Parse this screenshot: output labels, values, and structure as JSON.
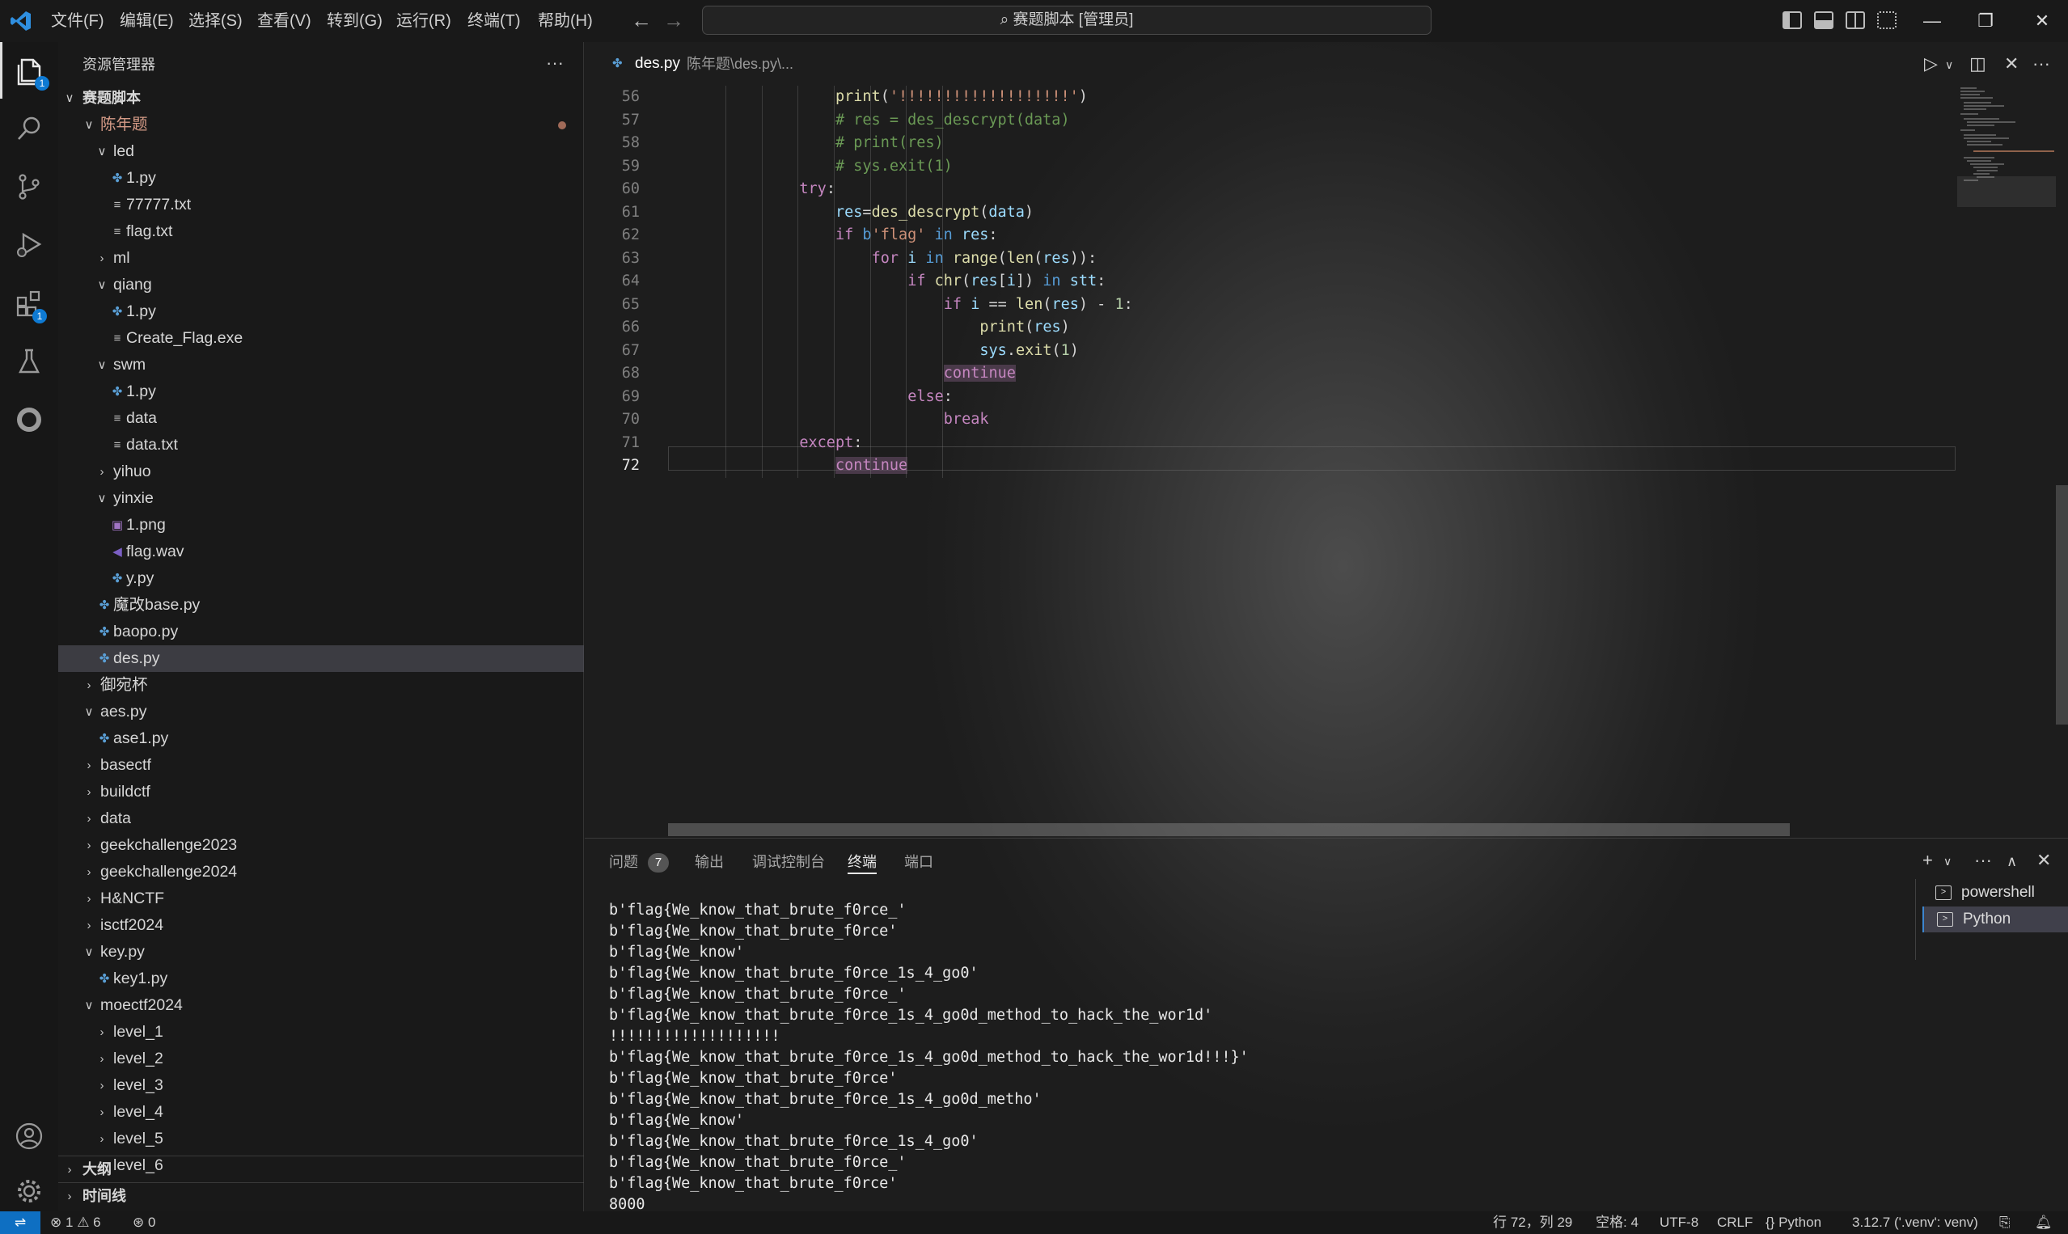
{
  "menu": [
    "文件(F)",
    "编辑(E)",
    "选择(S)",
    "查看(V)",
    "转到(G)",
    "运行(R)",
    "终端(T)",
    "帮助(H)"
  ],
  "command_center": "赛题脚本 [管理员]",
  "activity": {
    "explorer_badge": "1",
    "extensions_badge": "1"
  },
  "sidebar": {
    "title": "资源管理器",
    "more": "···",
    "root": "赛题脚本",
    "tree": [
      {
        "label": "陈年题",
        "depth": 1,
        "type": "folder-open",
        "modified": true
      },
      {
        "label": "led",
        "depth": 2,
        "type": "folder-open"
      },
      {
        "label": "1.py",
        "depth": 3,
        "type": "py"
      },
      {
        "label": "77777.txt",
        "depth": 3,
        "type": "txt"
      },
      {
        "label": "flag.txt",
        "depth": 3,
        "type": "txt"
      },
      {
        "label": "ml",
        "depth": 2,
        "type": "folder"
      },
      {
        "label": "qiang",
        "depth": 2,
        "type": "folder-open"
      },
      {
        "label": "1.py",
        "depth": 3,
        "type": "py"
      },
      {
        "label": "Create_Flag.exe",
        "depth": 3,
        "type": "txt"
      },
      {
        "label": "swm",
        "depth": 2,
        "type": "folder-open"
      },
      {
        "label": "1.py",
        "depth": 3,
        "type": "py"
      },
      {
        "label": "data",
        "depth": 3,
        "type": "txt"
      },
      {
        "label": "data.txt",
        "depth": 3,
        "type": "txt"
      },
      {
        "label": "yihuo",
        "depth": 2,
        "type": "folder"
      },
      {
        "label": "yinxie",
        "depth": 2,
        "type": "folder-open"
      },
      {
        "label": "1.png",
        "depth": 3,
        "type": "img"
      },
      {
        "label": "flag.wav",
        "depth": 3,
        "type": "wav"
      },
      {
        "label": "y.py",
        "depth": 3,
        "type": "py"
      },
      {
        "label": "魔改base.py",
        "depth": 2,
        "type": "py"
      },
      {
        "label": "baopo.py",
        "depth": 2,
        "type": "py"
      },
      {
        "label": "des.py",
        "depth": 2,
        "type": "py",
        "selected": true
      },
      {
        "label": "御宛杯",
        "depth": 1,
        "type": "folder"
      },
      {
        "label": "aes.py",
        "depth": 1,
        "type": "folder-open"
      },
      {
        "label": "ase1.py",
        "depth": 2,
        "type": "py"
      },
      {
        "label": "basectf",
        "depth": 1,
        "type": "folder"
      },
      {
        "label": "buildctf",
        "depth": 1,
        "type": "folder"
      },
      {
        "label": "data",
        "depth": 1,
        "type": "folder"
      },
      {
        "label": "geekchallenge2023",
        "depth": 1,
        "type": "folder"
      },
      {
        "label": "geekchallenge2024",
        "depth": 1,
        "type": "folder"
      },
      {
        "label": "H&NCTF",
        "depth": 1,
        "type": "folder"
      },
      {
        "label": "isctf2024",
        "depth": 1,
        "type": "folder"
      },
      {
        "label": "key.py",
        "depth": 1,
        "type": "folder-open"
      },
      {
        "label": "key1.py",
        "depth": 2,
        "type": "py"
      },
      {
        "label": "moectf2024",
        "depth": 1,
        "type": "folder-open"
      },
      {
        "label": "level_1",
        "depth": 2,
        "type": "folder"
      },
      {
        "label": "level_2",
        "depth": 2,
        "type": "folder"
      },
      {
        "label": "level_3",
        "depth": 2,
        "type": "folder"
      },
      {
        "label": "level_4",
        "depth": 2,
        "type": "folder"
      },
      {
        "label": "level_5",
        "depth": 2,
        "type": "folder"
      },
      {
        "label": "level_6",
        "depth": 2,
        "type": "folder"
      }
    ],
    "outline": "大纲",
    "timeline": "时间线"
  },
  "editor": {
    "tab_title": "des.py",
    "tab_path": "陈年题\\des.py\\...",
    "lines": [
      {
        "n": "56",
        "indent": 5,
        "tokens": [
          [
            "fn",
            "print"
          ],
          [
            "p",
            "("
          ],
          [
            "str",
            "'!!!!!!!!!!!!!!!!!!!'"
          ],
          [
            "p",
            ")"
          ]
        ]
      },
      {
        "n": "57",
        "indent": 5,
        "tokens": [
          [
            "cm",
            "# res = des_descrypt(data)"
          ]
        ]
      },
      {
        "n": "58",
        "indent": 5,
        "tokens": [
          [
            "cm",
            "# print(res)"
          ]
        ]
      },
      {
        "n": "59",
        "indent": 5,
        "tokens": [
          [
            "cm",
            "# sys.exit(1)"
          ]
        ]
      },
      {
        "n": "60",
        "indent": 4,
        "tokens": [
          [
            "kw",
            "try"
          ],
          [
            "p",
            ":"
          ]
        ]
      },
      {
        "n": "61",
        "indent": 5,
        "tokens": [
          [
            "var",
            "res"
          ],
          [
            "p",
            "="
          ],
          [
            "fn",
            "des_descrypt"
          ],
          [
            "p",
            "("
          ],
          [
            "var",
            "data"
          ],
          [
            "p",
            ")"
          ]
        ]
      },
      {
        "n": "62",
        "indent": 5,
        "tokens": [
          [
            "kw",
            "if "
          ],
          [
            "kw2",
            "b"
          ],
          [
            "str",
            "'flag'"
          ],
          [
            "kw2",
            " in "
          ],
          [
            "var",
            "res"
          ],
          [
            "p",
            ":"
          ]
        ]
      },
      {
        "n": "63",
        "indent": 6,
        "tokens": [
          [
            "kw",
            "for "
          ],
          [
            "var",
            "i"
          ],
          [
            "kw2",
            " in "
          ],
          [
            "fn",
            "range"
          ],
          [
            "p",
            "("
          ],
          [
            "fn",
            "len"
          ],
          [
            "p",
            "("
          ],
          [
            "var",
            "res"
          ],
          [
            "p",
            "))"
          ],
          [
            "p",
            ":"
          ]
        ]
      },
      {
        "n": "64",
        "indent": 7,
        "tokens": [
          [
            "kw",
            "if "
          ],
          [
            "fn",
            "chr"
          ],
          [
            "p",
            "("
          ],
          [
            "var",
            "res"
          ],
          [
            "p",
            "["
          ],
          [
            "var",
            "i"
          ],
          [
            "p",
            "]) "
          ],
          [
            "kw2",
            "in "
          ],
          [
            "var",
            "stt"
          ],
          [
            "p",
            ":"
          ]
        ]
      },
      {
        "n": "65",
        "indent": 8,
        "tokens": [
          [
            "kw",
            "if "
          ],
          [
            "var",
            "i"
          ],
          [
            "p",
            " == "
          ],
          [
            "fn",
            "len"
          ],
          [
            "p",
            "("
          ],
          [
            "var",
            "res"
          ],
          [
            "p",
            ") - "
          ],
          [
            "num",
            "1"
          ],
          [
            "p",
            ":"
          ]
        ]
      },
      {
        "n": "66",
        "indent": 9,
        "tokens": [
          [
            "fn",
            "print"
          ],
          [
            "p",
            "("
          ],
          [
            "var",
            "res"
          ],
          [
            "p",
            ")"
          ]
        ]
      },
      {
        "n": "67",
        "indent": 9,
        "tokens": [
          [
            "var",
            "sys"
          ],
          [
            "p",
            "."
          ],
          [
            "fn",
            "exit"
          ],
          [
            "p",
            "("
          ],
          [
            "num",
            "1"
          ],
          [
            "p",
            ")"
          ]
        ]
      },
      {
        "n": "68",
        "indent": 8,
        "tokens": [
          [
            "kwhl",
            "continue"
          ]
        ]
      },
      {
        "n": "69",
        "indent": 7,
        "tokens": [
          [
            "kw",
            "else"
          ],
          [
            "p",
            ":"
          ]
        ]
      },
      {
        "n": "70",
        "indent": 8,
        "tokens": [
          [
            "kw",
            "break"
          ]
        ]
      },
      {
        "n": "71",
        "indent": 4,
        "tokens": [
          [
            "kw",
            "except"
          ],
          [
            "p",
            ":"
          ]
        ]
      },
      {
        "n": "72",
        "indent": 5,
        "tokens": [
          [
            "kwhl",
            "continue"
          ]
        ],
        "active": true
      }
    ]
  },
  "panel": {
    "tabs": [
      "问题",
      "输出",
      "调试控制台",
      "终端",
      "端口"
    ],
    "problems_count": "7",
    "terminal_lines": [
      "b'flag{We_know_that_brute_f0rce_'",
      "b'flag{We_know_that_brute_f0rce'",
      "b'flag{We_know'",
      "b'flag{We_know_that_brute_f0rce_1s_4_go0'",
      "b'flag{We_know_that_brute_f0rce_'",
      "b'flag{We_know_that_brute_f0rce_1s_4_go0d_method_to_hack_the_wor1d'",
      "!!!!!!!!!!!!!!!!!!!",
      "b'flag{We_know_that_brute_f0rce_1s_4_go0d_method_to_hack_the_wor1d!!!}'",
      "b'flag{We_know_that_brute_f0rce'",
      "b'flag{We_know_that_brute_f0rce_1s_4_go0d_metho'",
      "b'flag{We_know'",
      "b'flag{We_know_that_brute_f0rce_1s_4_go0'",
      "b'flag{We_know_that_brute_f0rce_'",
      "b'flag{We_know_that_brute_f0rce'",
      "8000"
    ],
    "terminals": [
      "powershell",
      "Python"
    ]
  },
  "statusbar": {
    "errors": "1",
    "warnings": "6",
    "ports": "0",
    "position": "行 72，列 29",
    "spaces": "空格: 4",
    "encoding": "UTF-8",
    "eol": "CRLF",
    "language": "Python",
    "interpreter": "3.12.7 ('.venv': venv)"
  }
}
